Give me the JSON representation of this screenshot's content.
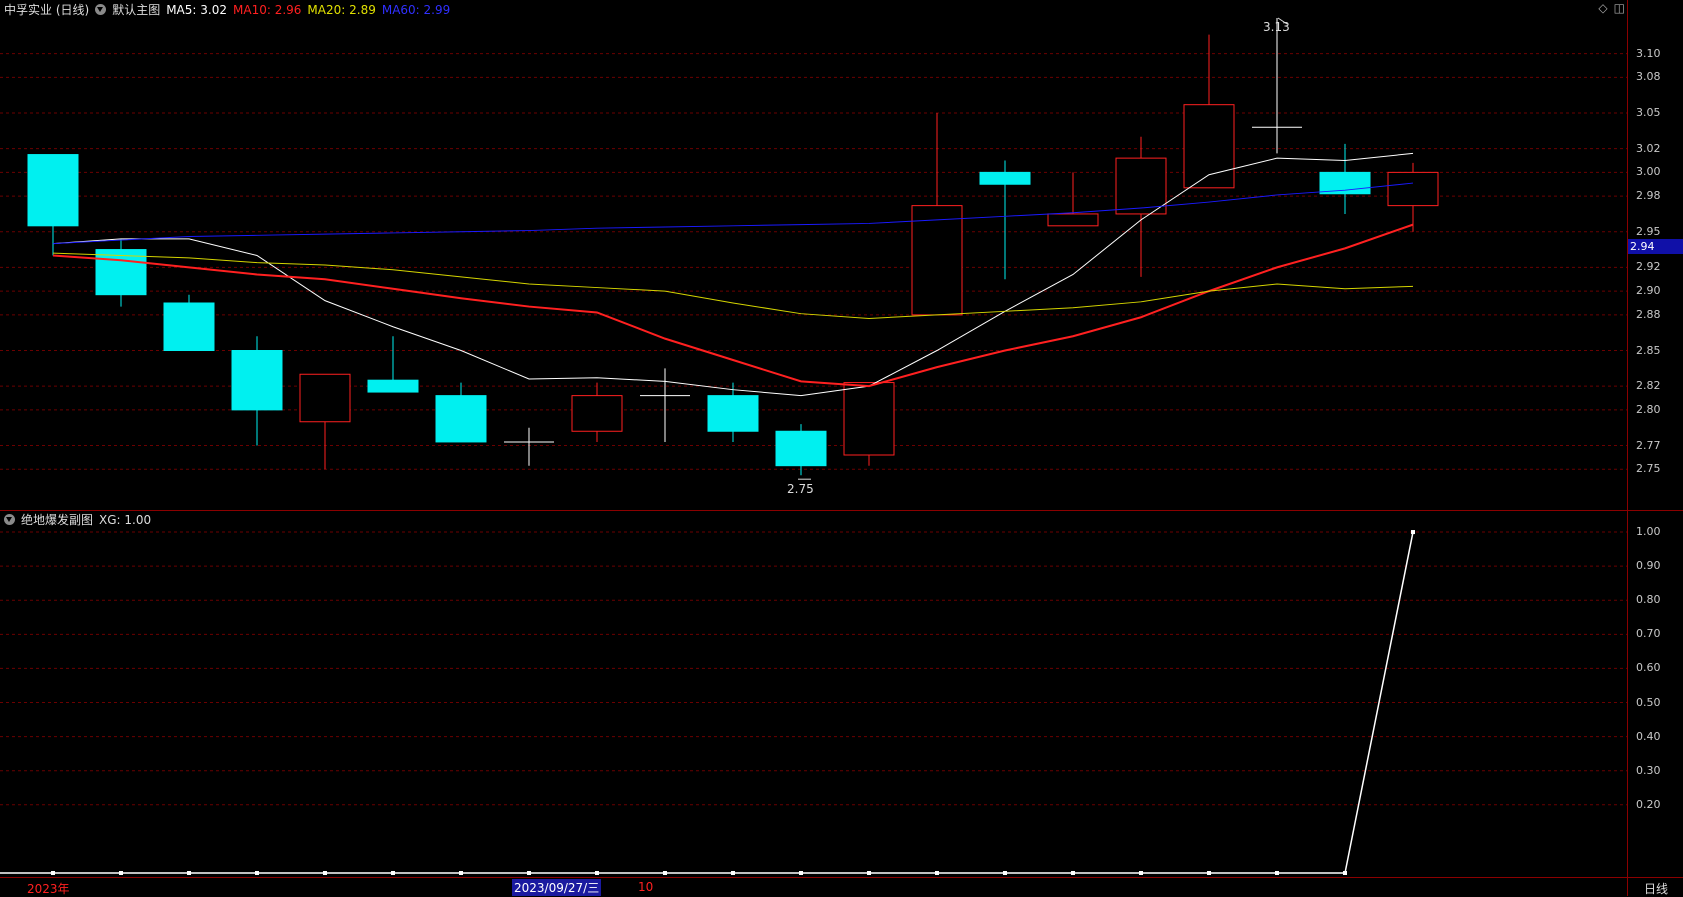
{
  "main_header": {
    "stock": "中孚实业 (日线)",
    "template": "默认主图",
    "ma5_label": "MA5:",
    "ma5_value": "3.02",
    "ma10_label": "MA10:",
    "ma10_value": "2.96",
    "ma20_label": "MA20:",
    "ma20_value": "2.89",
    "ma60_label": "MA60:",
    "ma60_value": "2.99"
  },
  "sub_header": {
    "title": "绝地爆发副图",
    "xg_label": "XG:",
    "xg_value": "1.00"
  },
  "price_tag": "2.94",
  "annotations": {
    "high": "3.13",
    "low": "2.75"
  },
  "xaxis": {
    "year": "2023年",
    "cursor_date": "2023/09/27/三",
    "month": "10",
    "period": "日线"
  },
  "colors": {
    "up": "#ff2020",
    "down": "#00f0f0",
    "ma5": "#ffffff",
    "ma10": "#ff2020",
    "ma20": "#d4d400",
    "ma60": "#1a1aff",
    "grid": "#6b0000"
  },
  "chart_data": [
    {
      "type": "candlestick",
      "ylim": [
        2.73,
        3.13
      ],
      "yticks": [
        "2.75",
        "2.77",
        "2.80",
        "2.82",
        "2.85",
        "2.88",
        "2.90",
        "2.92",
        "2.95",
        "2.98",
        "3.00",
        "3.02",
        "3.05",
        "3.08",
        "3.10"
      ],
      "candles": [
        {
          "o": 3.015,
          "c": 2.955,
          "h": 3.015,
          "l": 2.93
        },
        {
          "o": 2.935,
          "c": 2.897,
          "h": 2.944,
          "l": 2.887
        },
        {
          "o": 2.89,
          "c": 2.85,
          "h": 2.897,
          "l": 2.85
        },
        {
          "o": 2.85,
          "c": 2.8,
          "h": 2.862,
          "l": 2.77
        },
        {
          "o": 2.79,
          "c": 2.83,
          "h": 2.83,
          "l": 2.75
        },
        {
          "o": 2.825,
          "c": 2.815,
          "h": 2.862,
          "l": 2.815
        },
        {
          "o": 2.812,
          "c": 2.773,
          "h": 2.823,
          "l": 2.773
        },
        {
          "o": 2.773,
          "c": 2.773,
          "h": 2.785,
          "l": 2.753
        },
        {
          "o": 2.782,
          "c": 2.812,
          "h": 2.823,
          "l": 2.773
        },
        {
          "o": 2.812,
          "c": 2.812,
          "h": 2.835,
          "l": 2.773
        },
        {
          "o": 2.812,
          "c": 2.782,
          "h": 2.823,
          "l": 2.773
        },
        {
          "o": 2.782,
          "c": 2.753,
          "h": 2.788,
          "l": 2.745
        },
        {
          "o": 2.762,
          "c": 2.823,
          "h": 2.823,
          "l": 2.753
        },
        {
          "o": 2.88,
          "c": 2.972,
          "h": 3.05,
          "l": 2.88
        },
        {
          "o": 3.0,
          "c": 2.99,
          "h": 3.01,
          "l": 2.91
        },
        {
          "o": 2.955,
          "c": 2.965,
          "h": 3.0,
          "l": 2.955
        },
        {
          "o": 2.965,
          "c": 3.012,
          "h": 3.03,
          "l": 2.912
        },
        {
          "o": 2.987,
          "c": 3.057,
          "h": 3.116,
          "l": 2.987
        },
        {
          "o": 3.038,
          "c": 3.038,
          "h": 3.13,
          "l": 3.016
        },
        {
          "o": 3.0,
          "c": 2.982,
          "h": 3.024,
          "l": 2.965
        },
        {
          "o": 2.972,
          "c": 3.0,
          "h": 3.008,
          "l": 2.95
        }
      ],
      "series": [
        {
          "name": "MA5",
          "values": [
            2.94,
            2.944,
            2.944,
            2.93,
            2.892,
            2.87,
            2.85,
            2.826,
            2.827,
            2.824,
            2.817,
            2.812,
            2.82,
            2.85,
            2.883,
            2.914,
            2.96,
            2.998,
            3.012,
            3.01,
            3.016
          ]
        },
        {
          "name": "MA10",
          "values": [
            2.93,
            2.926,
            2.92,
            2.914,
            2.91,
            2.902,
            2.894,
            2.887,
            2.882,
            2.86,
            2.842,
            2.824,
            2.82,
            2.836,
            2.85,
            2.862,
            2.878,
            2.9,
            2.92,
            2.936,
            2.956
          ]
        },
        {
          "name": "MA20",
          "values": [
            2.932,
            2.93,
            2.928,
            2.924,
            2.922,
            2.918,
            2.912,
            2.906,
            2.903,
            2.9,
            2.89,
            2.881,
            2.877,
            2.88,
            2.883,
            2.886,
            2.891,
            2.9,
            2.906,
            2.902,
            2.904
          ]
        },
        {
          "name": "MA60",
          "values": [
            2.94,
            2.943,
            2.946,
            2.947,
            2.948,
            2.949,
            2.95,
            2.951,
            2.953,
            2.954,
            2.955,
            2.956,
            2.957,
            2.96,
            2.963,
            2.966,
            2.97,
            2.975,
            2.981,
            2.985,
            2.991
          ]
        }
      ]
    },
    {
      "type": "line",
      "ylim": [
        0.0,
        1.05
      ],
      "yticks": [
        "0.20",
        "0.30",
        "0.40",
        "0.50",
        "0.60",
        "0.70",
        "0.80",
        "0.90",
        "1.00"
      ],
      "series": [
        {
          "name": "XG",
          "values": [
            0,
            0,
            0,
            0,
            0,
            0,
            0,
            0,
            0,
            0,
            0,
            0,
            0,
            0,
            0,
            0,
            0,
            0,
            0,
            0,
            1
          ]
        }
      ]
    }
  ]
}
